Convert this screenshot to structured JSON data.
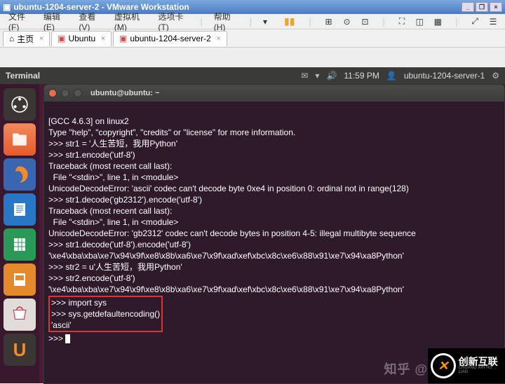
{
  "window": {
    "title": "ubuntu-1204-server-2 - VMware Workstation",
    "min": "_",
    "max": "❐",
    "close": "×"
  },
  "menu": {
    "file": "文件(F)",
    "edit": "编辑(E)",
    "view": "查看(V)",
    "vm": "虚拟机(M)",
    "tabs": "选项卡(T)",
    "help": "帮助(H)"
  },
  "tabs": {
    "home": "主页",
    "t1": "Ubuntu",
    "t2": "ubuntu-1204-server-2"
  },
  "ubuntu_panel": {
    "app": "Terminal",
    "time": "11:59 PM",
    "user": "ubuntu-1204-server-1"
  },
  "term": {
    "title": "ubuntu@ubuntu: ~",
    "l0": "[GCC 4.6.3] on linux2",
    "l1": "Type \"help\", \"copyright\", \"credits\" or \"license\" for more information.",
    "l2": ">>> str1 = '人生苦短，我用Python'",
    "l3": ">>> str1.encode('utf-8')",
    "l4": "Traceback (most recent call last):",
    "l5": "  File \"<stdin>\", line 1, in <module>",
    "l6": "UnicodeDecodeError: 'ascii' codec can't decode byte 0xe4 in position 0: ordinal not in range(128)",
    "l7": ">>> str1.decode('gb2312').encode('utf-8')",
    "l8": "Traceback (most recent call last):",
    "l9": "  File \"<stdin>\", line 1, in <module>",
    "l10": "UnicodeDecodeError: 'gb2312' codec can't decode bytes in position 4-5: illegal multibyte sequence",
    "l11": ">>> str1.decode('utf-8').encode('utf-8')",
    "l12": "'\\xe4\\xba\\xba\\xe7\\x94\\x9f\\xe8\\x8b\\xa6\\xe7\\x9f\\xad\\xef\\xbc\\x8c\\xe6\\x88\\x91\\xe7\\x94\\xa8Python'",
    "l13": ">>> str2 = u'人生苦短，我用Python'",
    "l14": ">>> str2.encode('utf-8')",
    "l15": "'\\xe4\\xba\\xba\\xe7\\x94\\x9f\\xe8\\x8b\\xa6\\xe7\\x9f\\xad\\xef\\xbc\\x8c\\xe6\\x88\\x91\\xe7\\x94\\xa8Python'",
    "l16": ">>> import sys",
    "l17": ">>> sys.getdefaultencoding()",
    "l18": "'ascii'",
    "l19": ">>> "
  },
  "watermark": "知乎 @",
  "brand": {
    "name": "创新互联",
    "sub": "CHUANG XIN HU LIAN"
  }
}
